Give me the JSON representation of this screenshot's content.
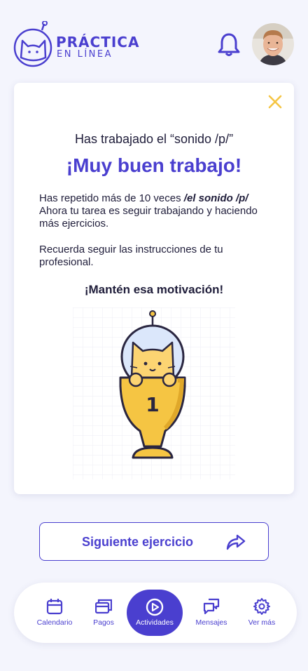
{
  "header": {
    "brand_title": "PRÁCTICA",
    "brand_subtitle": "EN LÍNEA",
    "bell_icon": "bell-icon",
    "avatar": "user-avatar"
  },
  "card": {
    "close_icon": "close-icon",
    "subtitle": "Has trabajado el “sonido /p/”",
    "headline": "¡Muy buen trabajo!",
    "paragraph1_prefix": "Has repetido más de 10 veces ",
    "paragraph1_emphasis": "/el sonido /p/",
    "paragraph1_suffix": " Ahora tu tarea es seguir trabajando y haciendo más ejercicios.",
    "paragraph2": "Recuerda seguir las instrucciones de tu profesional.",
    "motivation": "¡Mantén esa motivación!",
    "trophy_number": "1"
  },
  "next_button": {
    "label": "Siguiente ejercicio",
    "icon": "share-arrow-icon"
  },
  "bottom_nav": {
    "items": [
      {
        "label": "Calendario",
        "icon": "calendar-icon"
      },
      {
        "label": "Pagos",
        "icon": "cards-icon"
      },
      {
        "label": "Actividades",
        "icon": "play-icon",
        "active": true
      },
      {
        "label": "Mensajes",
        "icon": "chat-icon"
      },
      {
        "label": "Ver más",
        "icon": "gear-icon"
      }
    ]
  },
  "colors": {
    "accent": "#4a3fcf",
    "background": "#f4f5fd",
    "close": "#f5c543",
    "trophy": "#f5c543",
    "cat": "#fcd472"
  }
}
